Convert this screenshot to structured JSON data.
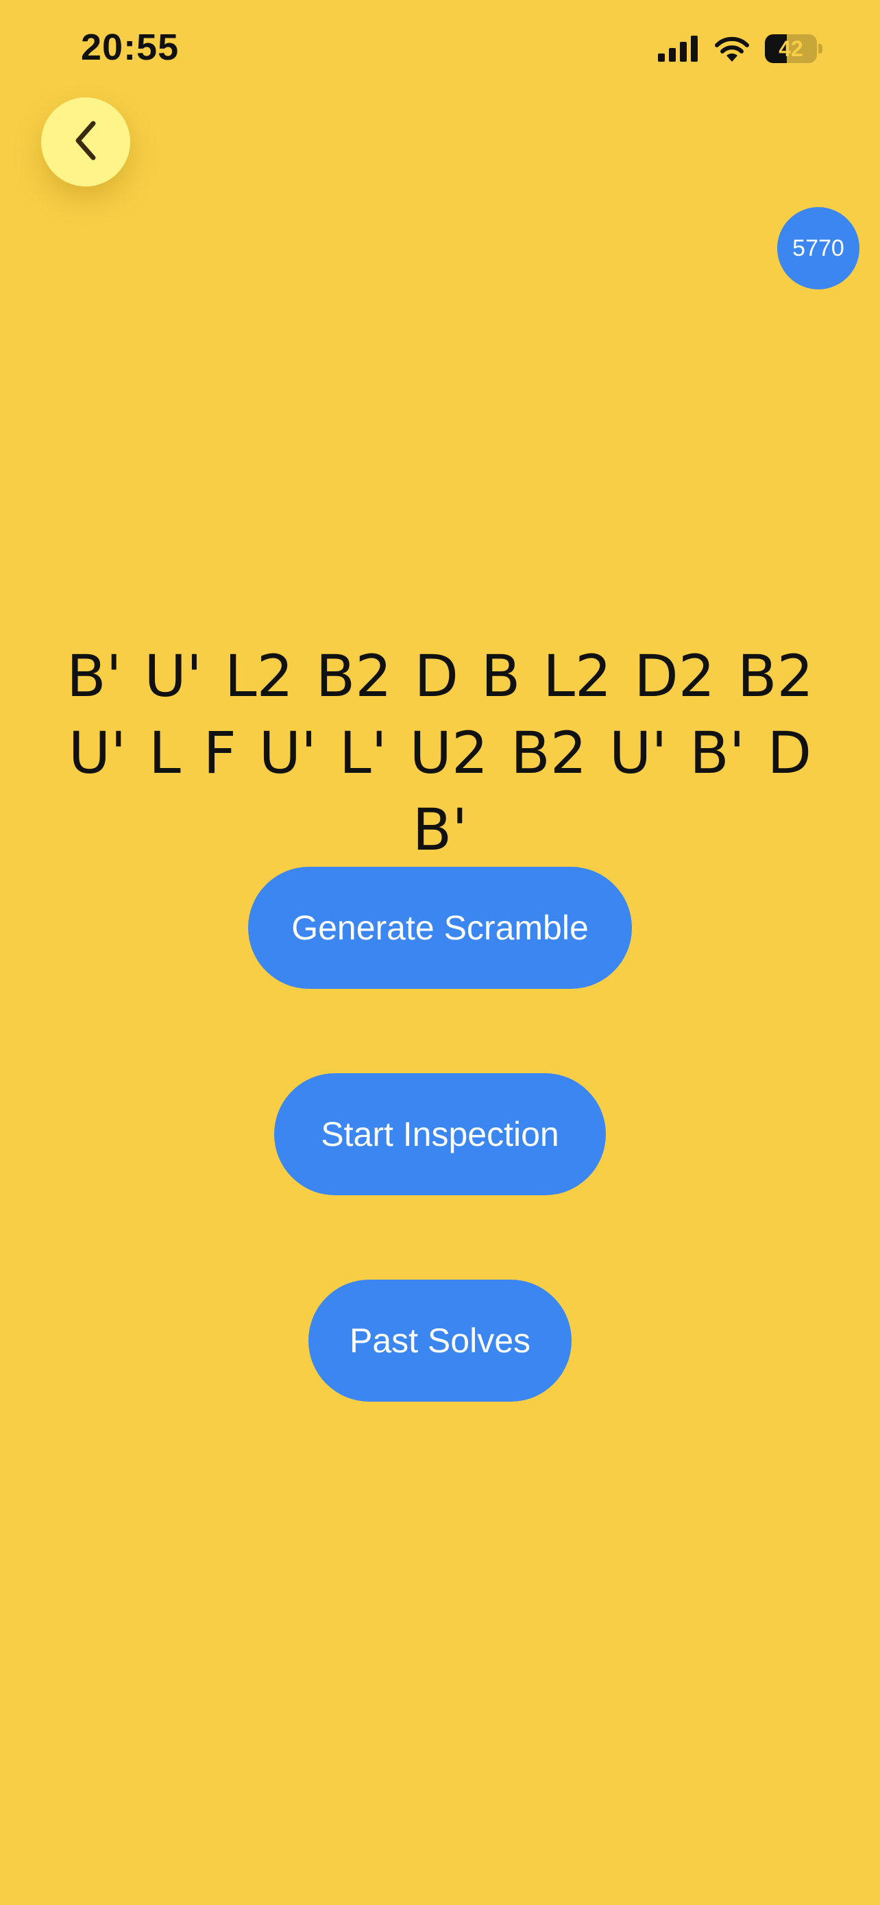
{
  "status_bar": {
    "time": "20:55",
    "battery_level": "42",
    "battery_fraction": 0.42,
    "icons": [
      "signal-icon",
      "wifi-icon",
      "battery-icon"
    ]
  },
  "nav": {
    "back_icon": "chevron-left-icon"
  },
  "solve_count_badge": "5770",
  "scramble": "B' U' L2 B2 D B L2 D2 B2 U' L F U' L' U2 B2 U' B' D B'",
  "buttons": {
    "generate_scramble": "Generate Scramble",
    "start_inspection": "Start Inspection",
    "past_solves": "Past Solves"
  },
  "colors": {
    "background": "#F7CE46",
    "back_button": "#FEF48A",
    "accent_blue": "#3B86F0",
    "text": "#111111"
  }
}
